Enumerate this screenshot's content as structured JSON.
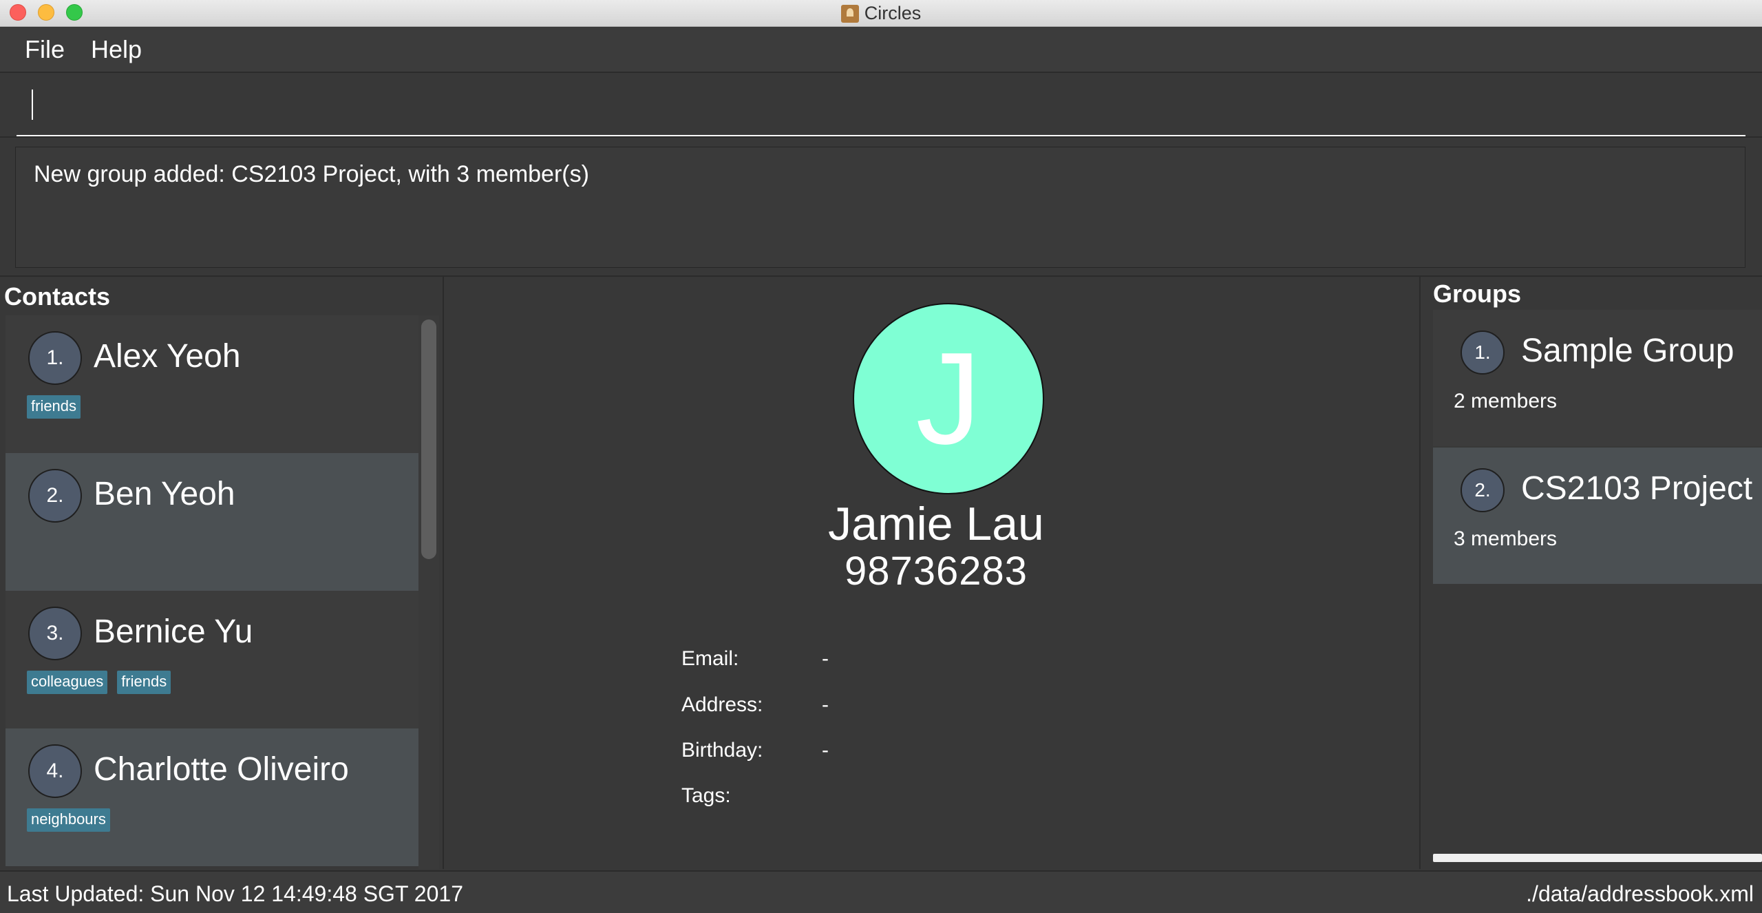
{
  "window": {
    "title": "Circles"
  },
  "menu": {
    "items": [
      "File",
      "Help"
    ]
  },
  "command": {
    "value": ""
  },
  "result": {
    "text": "New group added: CS2103 Project, with 3 member(s)"
  },
  "contacts": {
    "title": "Contacts",
    "items": [
      {
        "index": "1.",
        "name": "Alex Yeoh",
        "tags": [
          "friends"
        ]
      },
      {
        "index": "2.",
        "name": "Ben Yeoh",
        "tags": []
      },
      {
        "index": "3.",
        "name": "Bernice Yu",
        "tags": [
          "colleagues",
          "friends"
        ]
      },
      {
        "index": "4.",
        "name": "Charlotte Oliveiro",
        "tags": [
          "neighbours"
        ]
      }
    ]
  },
  "detail": {
    "avatar_letter": "J",
    "avatar_color": "#7fffd4",
    "name": "Jamie Lau",
    "phone": "98736283",
    "fields": [
      {
        "label": "Email:",
        "value": "-"
      },
      {
        "label": "Address:",
        "value": "-"
      },
      {
        "label": "Birthday:",
        "value": "-"
      },
      {
        "label": "Tags:",
        "value": ""
      }
    ]
  },
  "groups": {
    "title": "Groups",
    "items": [
      {
        "index": "1.",
        "name": "Sample Group",
        "members": "2 members"
      },
      {
        "index": "2.",
        "name": "CS2103 Project",
        "members": "3 members"
      }
    ]
  },
  "status": {
    "last_updated": "Last Updated: Sun Nov 12 14:49:48 SGT 2017",
    "file_path": "./data/addressbook.xml"
  },
  "colors": {
    "background": "#383838",
    "tag": "#3e7b91",
    "index_circle": "#4f5a6b",
    "card_alt": "#4b5053"
  }
}
